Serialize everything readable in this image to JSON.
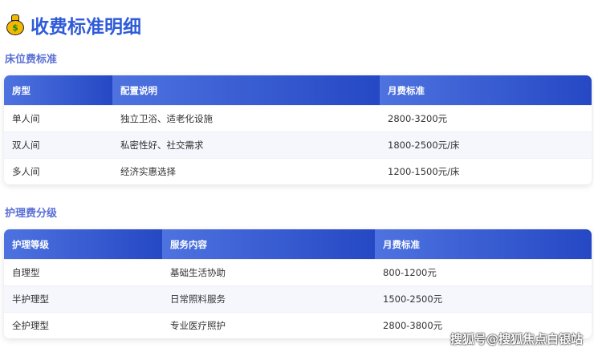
{
  "title": "收费标准明细",
  "icon": "money-bag-icon",
  "bed": {
    "heading": "床位费标准",
    "headers": [
      "房型",
      "配置说明",
      "月费标准"
    ],
    "rows": [
      [
        "单人间",
        "独立卫浴、适老化设施",
        "2800-3200元"
      ],
      [
        "双人间",
        "私密性好、社交需求",
        "1800-2500元/床"
      ],
      [
        "多人间",
        "经济实惠选择",
        "1200-1500元/床"
      ]
    ]
  },
  "care": {
    "heading": "护理费分级",
    "headers": [
      "护理等级",
      "服务内容",
      "月费标准"
    ],
    "rows": [
      [
        "自理型",
        "基础生活协助",
        "800-1200元"
      ],
      [
        "半护理型",
        "日常照料服务",
        "1500-2500元"
      ],
      [
        "全护理型",
        "专业医疗照护",
        "2800-3800元"
      ]
    ]
  },
  "watermark": "搜狐号@搜狐焦点白银站"
}
